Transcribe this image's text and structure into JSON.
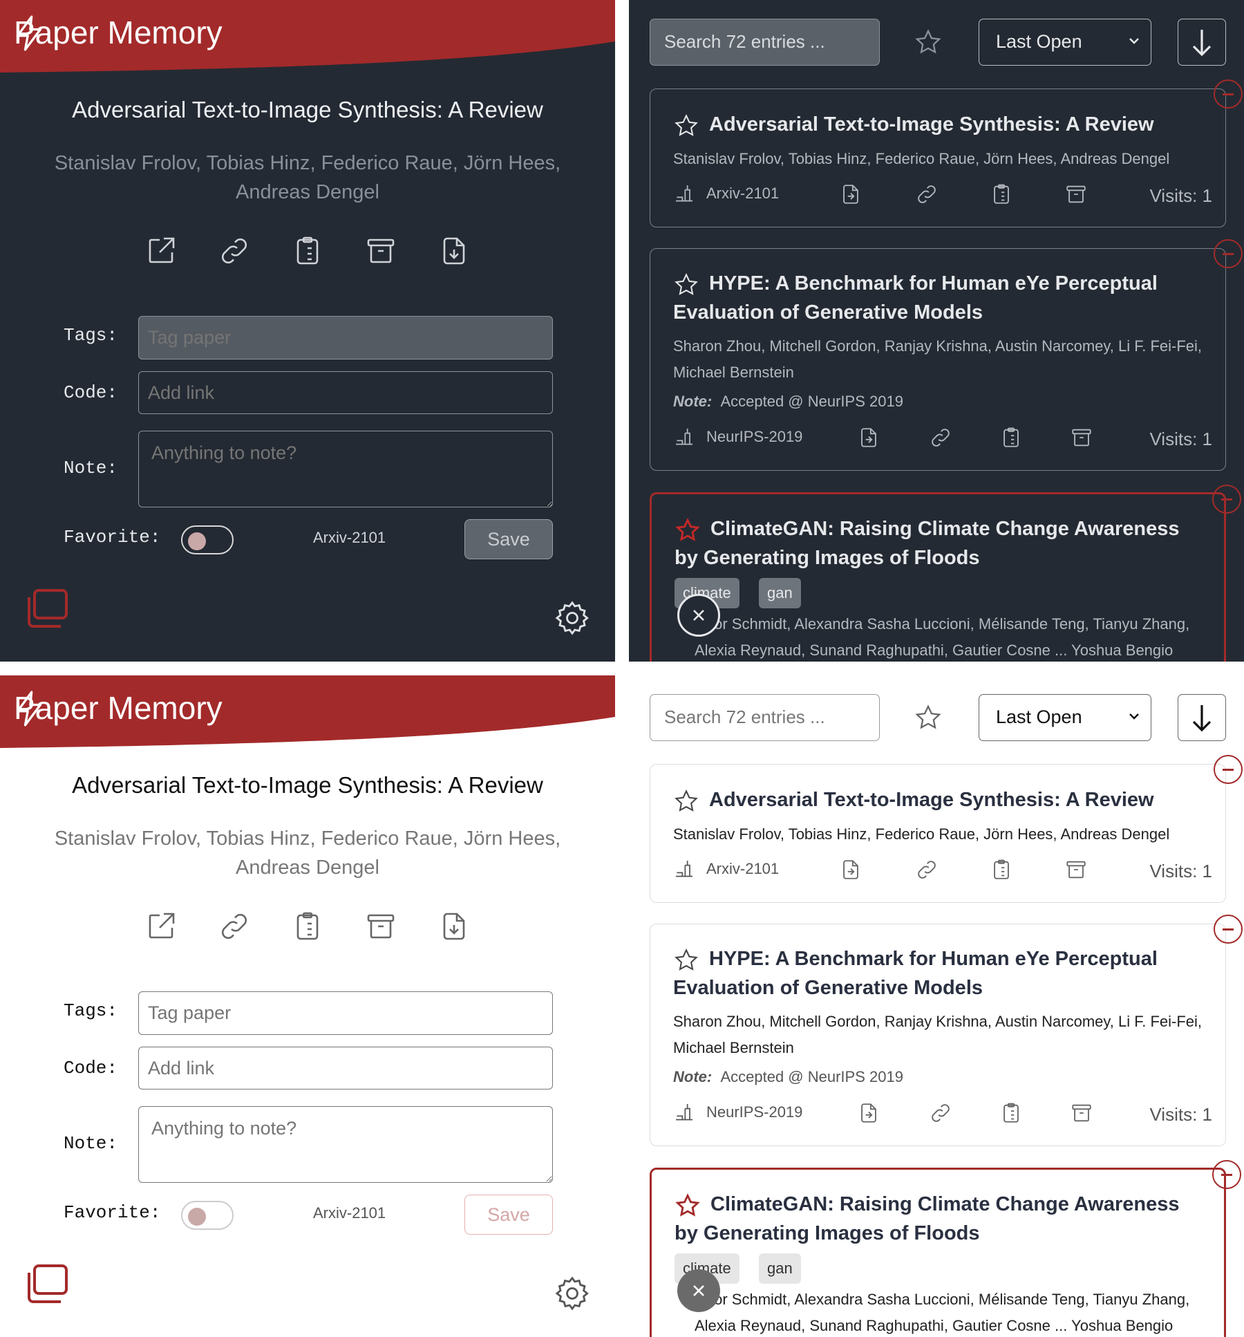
{
  "app": {
    "title": "Paper Memory",
    "brand_color": "#a32a2a"
  },
  "paper": {
    "title": "Adversarial Text-to-Image Synthesis: A Review",
    "authors": "Stanislav Frolov, Tobias Hinz, Federico Raue, Jörn Hees, Andreas Dengel",
    "venue": "Arxiv-2101"
  },
  "form": {
    "tags_label": "Tags:",
    "tags_placeholder": "Tag paper",
    "code_label": "Code:",
    "code_placeholder": "Add link",
    "note_label": "Note:",
    "note_placeholder": "Anything to note?",
    "favorite_label": "Favorite:",
    "save_label": "Save"
  },
  "list": {
    "search_placeholder": "Search 72 entries ...",
    "sort_selected": "Last Open",
    "note_prefix": "Note:",
    "items": [
      {
        "title": "Adversarial Text-to-Image Synthesis: A Review",
        "authors": "Stanislav Frolov, Tobias Hinz, Federico Raue, Jörn Hees, Andreas Dengel",
        "venue": "Arxiv-2101",
        "visits": "Visits: 1",
        "favorite": false
      },
      {
        "title": "HYPE: A Benchmark for Human eYe Perceptual Evaluation of Generative Models",
        "authors": "Sharon Zhou, Mitchell Gordon, Ranjay Krishna, Austin Narcomey, Li F. Fei-Fei, Michael Bernstein",
        "note": "Accepted @ NeurIPS 2019",
        "venue": "NeurIPS-2019",
        "visits": "Visits: 1",
        "favorite": false
      },
      {
        "title": "ClimateGAN: Raising Climate Change Awareness by Generating Images of Floods",
        "tags": [
          "climate",
          "gan"
        ],
        "authors": "…tor Schmidt, Alexandra Sasha Luccioni, Mélisande Teng, Tianyu Zhang, Alexia Reynaud, Sunand Raghupathi, Gautier Cosne ... Yoshua Bengio",
        "favorite": true
      }
    ]
  },
  "themes": [
    "dark",
    "light"
  ]
}
